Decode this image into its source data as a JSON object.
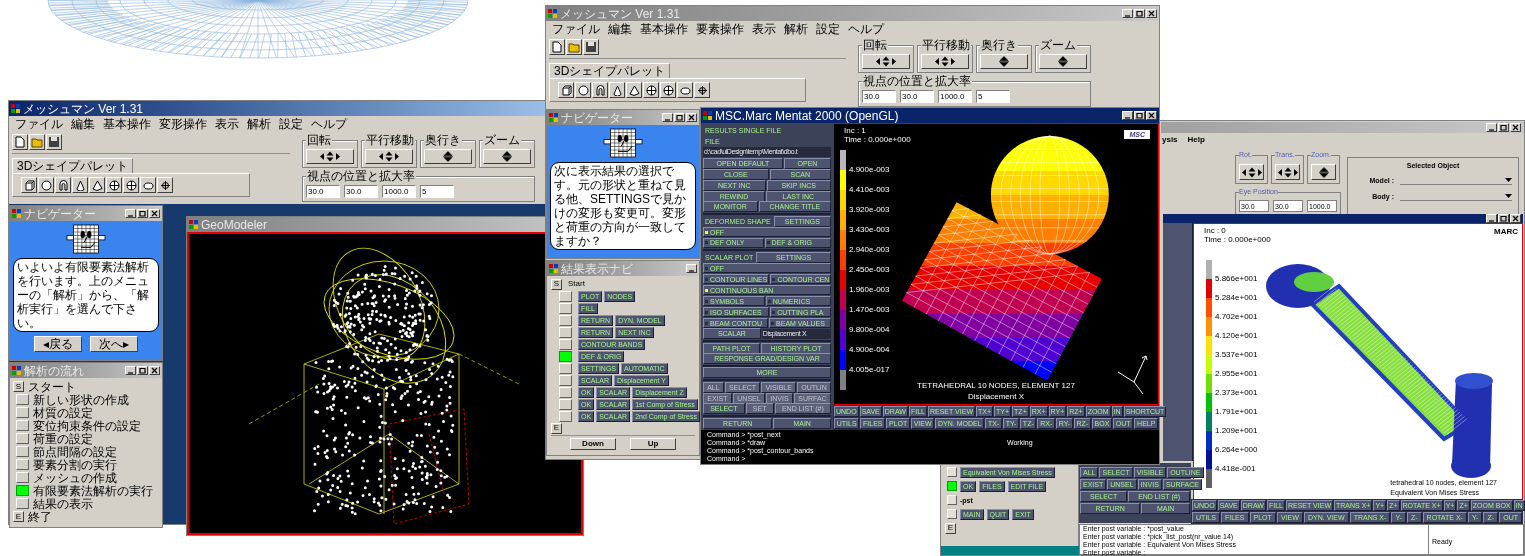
{
  "left_app": {
    "title": "メッシュマン Ver 1.31",
    "menus": [
      "ファイル",
      "編集",
      "基本操作",
      "変形操作",
      "表示",
      "解析",
      "設定",
      "ヘルプ"
    ],
    "palette_tab": "3Dシェイプパレット",
    "view_groups": [
      {
        "label": "回転",
        "kind": "four-way"
      },
      {
        "label": "平行移動",
        "kind": "four-way"
      },
      {
        "label": "奥行き",
        "kind": "two-way"
      },
      {
        "label": "ズーム",
        "kind": "two-way"
      }
    ],
    "position_label": "視点の位置と拡大率",
    "fields": [
      "30.0",
      "30.0",
      "1000.0",
      "5"
    ],
    "navigator": {
      "title": "ナビゲーター",
      "message": "いよいよ有限要素法解析を行います。上のメニューの「解析」から、「解析実行」を選んで下さい。",
      "buttons": [
        "◂戻る",
        "次へ▸"
      ]
    },
    "flow": {
      "title": "解析の流れ",
      "start_mark": "S",
      "start_label": "スタート",
      "end_mark": "E",
      "end_label": "終了",
      "steps": [
        {
          "label": "新しい形状の作成",
          "selected": false
        },
        {
          "label": "材質の設定",
          "selected": false
        },
        {
          "label": "変位拘束条件の設定",
          "selected": false
        },
        {
          "label": "荷重の設定",
          "selected": false
        },
        {
          "label": "節点間隔の設定",
          "selected": false
        },
        {
          "label": "要素分割の実行",
          "selected": false
        },
        {
          "label": "メッシュの作成",
          "selected": false
        },
        {
          "label": "有限要素法解析の実行",
          "selected": true
        },
        {
          "label": "結果の表示",
          "selected": false
        }
      ]
    },
    "viewport": {
      "title": "GeoModeler"
    }
  },
  "right_app": {
    "menus": [
      "ysis",
      "Help"
    ],
    "view_groups": [
      {
        "label": "Rot.",
        "kind": "four-way"
      },
      {
        "label": "Trans.",
        "kind": "four-way"
      },
      {
        "label": "Zoom.",
        "kind": "two-way"
      }
    ],
    "position_label": "Eye Position",
    "fields": [
      "30.0",
      "30.0",
      "1000.0"
    ],
    "selected_object": {
      "title": "Selected Object",
      "rows": [
        "Model :",
        "Body :"
      ]
    },
    "viewport": {
      "info": [
        "Inc :  0",
        "Time : 0.000e+000"
      ],
      "logo": "MARC",
      "caption": [
        "tetrahedral 10 nodes, element 127",
        "Equivalent Von Mises Stress"
      ],
      "legend": [
        {
          "color": "#b0b0b0"
        },
        {
          "color": "#e00000",
          "value": "5.866e+001"
        },
        {
          "color": "#ff5000",
          "value": "5.284e+001"
        },
        {
          "color": "#ff9000",
          "value": "4.702e+001"
        },
        {
          "color": "#ffe000",
          "value": "4.120e+001"
        },
        {
          "color": "#c8ff00",
          "value": "3.537e+001"
        },
        {
          "color": "#70e000",
          "value": "2.955e+001"
        },
        {
          "color": "#00c000",
          "value": "2.373e+001"
        },
        {
          "color": "#008060",
          "value": "1.791e+001"
        },
        {
          "color": "#0030c0",
          "value": "1.209e+001"
        },
        {
          "color": "#001090",
          "value": "6.264e+000"
        },
        {
          "color": "#606060",
          "value": "4.418e-001"
        }
      ]
    },
    "flow": {
      "end_mark": "E",
      "rows": [
        {
          "kind": "buttons",
          "items": [
            "Equivalent Von Mises Stress"
          ],
          "selected": false
        },
        {
          "kind": "buttons",
          "items": [
            "OK",
            "FILES",
            "EDIT FILE"
          ],
          "selected": true
        },
        {
          "kind": "label",
          "items": [
            "-pst"
          ],
          "selected": false
        },
        {
          "kind": "buttons",
          "items": [
            "MAIN",
            "QUIT",
            "EXIT"
          ],
          "selected": false
        }
      ]
    },
    "panel": [
      {
        "items": [
          {
            "kind": "button",
            "label": "ALL"
          },
          {
            "kind": "button",
            "label": "SELECT"
          },
          {
            "kind": "button",
            "label": "VISIBLE"
          },
          {
            "kind": "button",
            "label": "OUTLINE"
          }
        ]
      },
      {
        "items": [
          {
            "kind": "button",
            "label": "EXIST"
          },
          {
            "kind": "button",
            "label": "UNSEL"
          },
          {
            "kind": "button",
            "label": "INVIS"
          },
          {
            "kind": "button",
            "label": "SURFACE"
          }
        ]
      },
      {
        "items": [
          {
            "kind": "button",
            "label": "SELECT"
          },
          {
            "kind": "button",
            "label": "END LIST (#)"
          }
        ]
      },
      {
        "items": [
          {
            "kind": "button",
            "label": "RETURN"
          },
          {
            "kind": "button",
            "label": "MAIN"
          }
        ]
      }
    ],
    "toolbar": [
      [
        "UNDO",
        "SAVE",
        "DRAW",
        "FILL",
        "RESET VIEW",
        "TRANS X+",
        "Y+",
        "Z+",
        "ROTATE X+",
        "Y+",
        "Z+",
        "ZOOM BOX",
        "IN"
      ],
      [
        "UTILS",
        "FILES",
        "PLOT",
        "VIEW",
        "DYN. VIEW",
        "TRANS X-",
        "Y-",
        "Z-",
        "ROTATE X-",
        "Y-",
        "Z-",
        "OUT"
      ]
    ],
    "command": {
      "lines": [
        "Enter post variable : *post_value",
        "Enter post variable : *pick_list_post(nr_value 14)",
        "Enter post variable : Equivalent Von Mises Stress",
        "Enter post variable :"
      ],
      "status": "Ready"
    }
  },
  "middle_app": {
    "title": "メッシュマン Ver 1.31",
    "menus": [
      "ファイル",
      "編集",
      "基本操作",
      "要素操作",
      "表示",
      "解析",
      "設定",
      "ヘルプ"
    ],
    "palette_tab": "3Dシェイプパレット",
    "view_groups": [
      {
        "label": "回転",
        "kind": "four-way"
      },
      {
        "label": "平行移動",
        "kind": "four-way"
      },
      {
        "label": "奥行き",
        "kind": "two-way"
      },
      {
        "label": "ズーム",
        "kind": "two-way"
      }
    ],
    "position_label": "視点の位置と拡大率",
    "fields": [
      "30.0",
      "30.0",
      "1000.0",
      "5"
    ],
    "navigator": {
      "title": "ナビゲーター",
      "message": "次に表示結果の選択です。元の形状と重ねて見る他、SETTINGSで見かけの変形も変更可。変形と荷重の方向が一致してますか？"
    },
    "results_nav": {
      "title": "結果表示ナビ",
      "start_mark": "S",
      "start_label": "Start",
      "end_mark": "E",
      "buttons": [
        "Down",
        "Up"
      ],
      "rows": [
        {
          "items": [
            "PLOT",
            "NODES"
          ],
          "selected": false
        },
        {
          "items": [
            "FILL"
          ],
          "selected": false
        },
        {
          "items": [
            "RETURN",
            "DYN. MODEL"
          ],
          "selected": false
        },
        {
          "items": [
            "RETURN",
            "NEXT INC"
          ],
          "selected": false
        },
        {
          "items": [
            "CONTOUR BANDS"
          ],
          "selected": false
        },
        {
          "items": [
            "DEF & ORIG"
          ],
          "selected": true
        },
        {
          "items": [
            "SETTINGS",
            "AUTOMATIC"
          ],
          "selected": false
        },
        {
          "items": [
            "SCALAR",
            "Displacement Y"
          ],
          "selected": false
        },
        {
          "items": [
            "OK",
            "SCALAR",
            "Displacement Z"
          ],
          "selected": false
        },
        {
          "items": [
            "OK",
            "SCALAR",
            "1st Comp of Stress"
          ],
          "selected": false
        },
        {
          "items": [
            "OK",
            "SCALAR",
            "2nd Comp of Stress"
          ],
          "selected": false
        }
      ]
    },
    "mentat": {
      "title": "MSC.Marc Mentat 2000 (OpenGL)",
      "panel": [
        {
          "divider": false,
          "items": [
            {
              "kind": "title",
              "label": "RESULTS   SINGLE FILE"
            }
          ]
        },
        {
          "divider": false,
          "items": [
            {
              "kind": "title",
              "label": "FILE"
            }
          ]
        },
        {
          "divider": false,
          "items": [
            {
              "kind": "field",
              "label": "d:\\cad\\uiDesign\\temp\\Mentat\\dbo.t"
            }
          ]
        },
        {
          "divider": false,
          "items": [
            {
              "kind": "button",
              "label": "OPEN DEFAULT"
            },
            {
              "kind": "button",
              "label": "OPEN"
            }
          ]
        },
        {
          "divider": false,
          "items": [
            {
              "kind": "button",
              "label": "CLOSE"
            },
            {
              "kind": "button",
              "label": "SCAN"
            }
          ]
        },
        {
          "divider": false,
          "items": [
            {
              "kind": "button",
              "label": "NEXT INC"
            },
            {
              "kind": "button",
              "label": "SKIP INCS"
            }
          ]
        },
        {
          "divider": false,
          "items": [
            {
              "kind": "button",
              "label": "REWIND"
            },
            {
              "kind": "button",
              "label": "LAST INC"
            }
          ]
        },
        {
          "divider": true,
          "items": [
            {
              "kind": "button",
              "label": "MONITOR"
            },
            {
              "kind": "button",
              "label": "CHANGE TITLE"
            }
          ]
        },
        {
          "divider": false,
          "items": [
            {
              "kind": "title",
              "label": "DEFORMED SHAPE"
            },
            {
              "kind": "button",
              "label": "SETTINGS"
            }
          ]
        },
        {
          "divider": false,
          "items": [
            {
              "kind": "radio",
              "label": "OFF",
              "on": true
            }
          ]
        },
        {
          "divider": true,
          "items": [
            {
              "kind": "radio",
              "label": "DEF ONLY",
              "on": false
            },
            {
              "kind": "radio",
              "label": "DEF & ORIG",
              "on": false
            }
          ]
        },
        {
          "divider": false,
          "items": [
            {
              "kind": "title",
              "label": "SCALAR PLOT"
            },
            {
              "kind": "button",
              "label": "SETTINGS"
            }
          ]
        },
        {
          "divider": false,
          "items": [
            {
              "kind": "radio",
              "label": "OFF",
              "on": false
            }
          ]
        },
        {
          "divider": false,
          "items": [
            {
              "kind": "radio",
              "label": "CONTOUR LINES",
              "on": false
            },
            {
              "kind": "radio",
              "label": "CONTOUR CEN",
              "on": false
            }
          ]
        },
        {
          "divider": false,
          "items": [
            {
              "kind": "radio",
              "label": "CONTINUOUS BAN",
              "on": true
            }
          ]
        },
        {
          "divider": false,
          "items": [
            {
              "kind": "radio",
              "label": "SYMBOLS",
              "on": false
            },
            {
              "kind": "radio",
              "label": "NUMERICS",
              "on": false
            }
          ]
        },
        {
          "divider": false,
          "items": [
            {
              "kind": "radio",
              "label": "ISO SURFACES",
              "on": false
            },
            {
              "kind": "radio",
              "label": "CUTTING PLA",
              "on": false
            }
          ]
        },
        {
          "divider": false,
          "items": [
            {
              "kind": "radio",
              "label": "BEAM CONTOU",
              "on": false
            },
            {
              "kind": "radio",
              "label": "BEAM VALUES",
              "on": false
            }
          ]
        },
        {
          "divider": true,
          "items": [
            {
              "kind": "button",
              "label": "SCALAR"
            },
            {
              "kind": "field",
              "label": "Displacement X"
            }
          ]
        },
        {
          "divider": false,
          "items": [
            {
              "kind": "button",
              "label": "PATH PLOT"
            },
            {
              "kind": "button",
              "label": "HISTORY PLOT"
            }
          ]
        },
        {
          "divider": true,
          "items": [
            {
              "kind": "button",
              "label": "RESPONSE GRAD/DESIGN VAR"
            }
          ]
        },
        {
          "divider": true,
          "items": [
            {
              "kind": "button",
              "label": "MORE"
            }
          ]
        },
        {
          "divider": false,
          "items": [
            {
              "kind": "disabled",
              "label": "ALL"
            },
            {
              "kind": "disabled",
              "label": "SELECT"
            },
            {
              "kind": "disabled",
              "label": "VISIBLE"
            },
            {
              "kind": "disabled",
              "label": "OUTLIN"
            }
          ]
        },
        {
          "divider": false,
          "items": [
            {
              "kind": "disabled",
              "label": "EXIST"
            },
            {
              "kind": "disabled",
              "label": "UNSEL"
            },
            {
              "kind": "disabled",
              "label": "INVIS"
            },
            {
              "kind": "disabled",
              "label": "SURFAC"
            }
          ]
        },
        {
          "divider": true,
          "items": [
            {
              "kind": "button",
              "label": "SELECT"
            },
            {
              "kind": "disabled",
              "label": "SET"
            },
            {
              "kind": "disabled",
              "label": "END LIST (#)"
            }
          ]
        },
        {
          "divider": false,
          "items": [
            {
              "kind": "button",
              "label": "RETURN"
            },
            {
              "kind": "button",
              "label": "MAIN"
            }
          ]
        }
      ],
      "viewport": {
        "info": [
          "Inc :  1",
          "Time : 0.000e+000"
        ],
        "logo": "MSC",
        "caption": [
          "TETRAHEDRAL 10 NODES, ELEMENT 127",
          "Displacement X"
        ],
        "legend": [
          {
            "color": "#b8b8b8"
          },
          {
            "color": "#ffff00",
            "value": "4.900e-003"
          },
          {
            "color": "#ffd800",
            "value": "4.410e-003"
          },
          {
            "color": "#ffb000",
            "value": "3.920e-003"
          },
          {
            "color": "#ff8000",
            "value": "3.430e-003"
          },
          {
            "color": "#ff4000",
            "value": "2.940e-003"
          },
          {
            "color": "#e80000",
            "value": "2.450e-003"
          },
          {
            "color": "#c00050",
            "value": "1.960e-003"
          },
          {
            "color": "#8000a0",
            "value": "1.470e-003"
          },
          {
            "color": "#5000d0",
            "value": "9.800e-004"
          },
          {
            "color": "#0000ff",
            "value": "4.900e-004"
          },
          {
            "color": "#808080",
            "value": "4.005e-017"
          }
        ]
      },
      "toolbar": [
        [
          "UNDO",
          "SAVE",
          "DRAW",
          "FILL",
          "RESET VIEW",
          "TX+",
          "TY+",
          "TZ+",
          "RX+",
          "RY+",
          "RZ+",
          "ZOOM",
          "IN",
          "SHORTCUT"
        ],
        [
          "UTILS",
          "FILES",
          "PLOT",
          "VIEW",
          "DYN. MODEL",
          "TX-",
          "TY-",
          "TZ-",
          "RX-",
          "RY-",
          "RZ-",
          "BOX",
          "OUT",
          "HELP"
        ]
      ],
      "command": {
        "lines": [
          "Command > *post_next",
          "Command > *draw",
          "Command > *post_contour_bands",
          "Command >"
        ],
        "status": "Working"
      }
    }
  }
}
